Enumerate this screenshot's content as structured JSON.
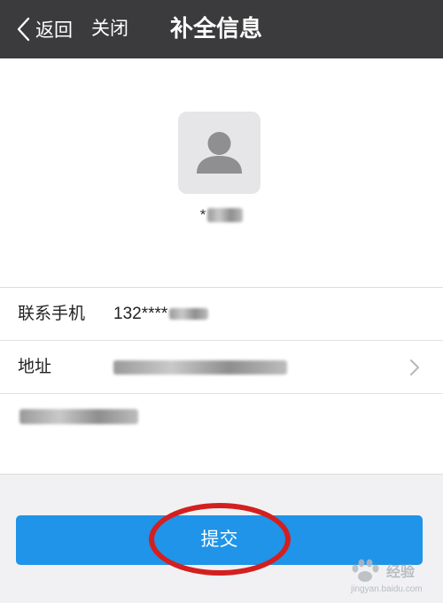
{
  "navbar": {
    "back_label": "返回",
    "close_label": "关闭",
    "title": "补全信息"
  },
  "profile": {
    "avatar_icon": "user-silhouette-icon",
    "name_prefix": "*"
  },
  "form": {
    "phone_label": "联系手机",
    "phone_value": "132****",
    "address_label": "地址",
    "address_chevron_icon": "chevron-right-icon"
  },
  "submit_label": "提交",
  "watermark": {
    "word": "经验",
    "url": "jingyan.baidu.com"
  },
  "colors": {
    "navbar": "#3b3b3d",
    "submit": "#1f94e8",
    "annotation_circle": "#d41f1f"
  }
}
